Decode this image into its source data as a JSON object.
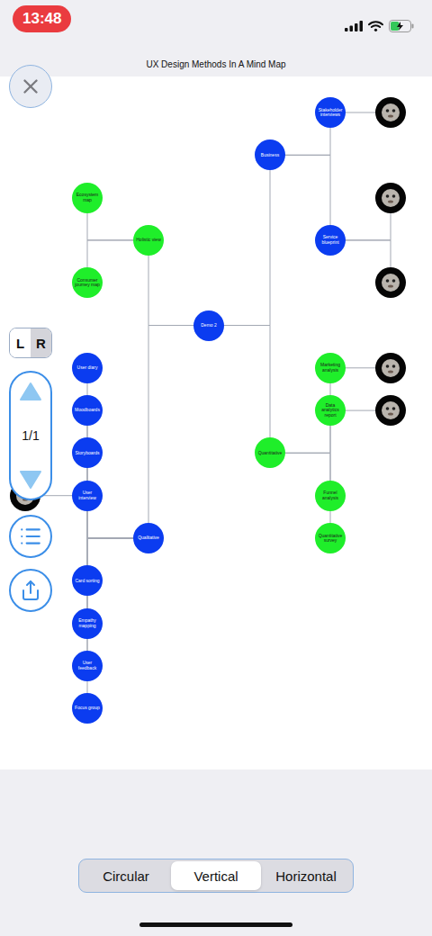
{
  "status_bar": {
    "time": "13:48",
    "battery": {
      "level": 0.45,
      "charging": true
    }
  },
  "title": "UX Design Methods In A Mind Map",
  "mindmap": {
    "root": {
      "label": "Demo 2",
      "color": "#0b3cf0"
    },
    "branches": [
      {
        "label": "Business",
        "color": "#0b3cf0",
        "children": [
          {
            "label": "Stakeholder interviews",
            "color": "#0b3cf0",
            "avatar_count": 1
          },
          {
            "label": "Service blueprint",
            "color": "#0b3cf0",
            "avatar_count": 2
          }
        ]
      },
      {
        "label": "Quantitative",
        "color": "#1fee2a",
        "children": [
          {
            "label": "Marketing analysis",
            "color": "#1fee2a",
            "avatar_count": 1
          },
          {
            "label": "Data analytics report",
            "color": "#1fee2a",
            "avatar_count": 1
          },
          {
            "label": "Funnel analysis",
            "color": "#1fee2a",
            "avatar_count": 0
          },
          {
            "label": "Quantitative survey",
            "color": "#1fee2a",
            "avatar_count": 0
          }
        ]
      },
      {
        "label": "Holistic view",
        "color": "#1fee2a",
        "children": [
          {
            "label": "Ecosystem map",
            "color": "#1fee2a",
            "avatar_count": 0
          },
          {
            "label": "Consumer journey map",
            "color": "#1fee2a",
            "avatar_count": 0
          }
        ]
      },
      {
        "label": "Qualitative",
        "color": "#0b3cf0",
        "children": [
          {
            "label": "User diary",
            "color": "#0b3cf0",
            "avatar_count": 0
          },
          {
            "label": "Moodboards",
            "color": "#0b3cf0",
            "avatar_count": 0
          },
          {
            "label": "Storyboards",
            "color": "#0b3cf0",
            "avatar_count": 0
          },
          {
            "label": "User interview",
            "color": "#0b3cf0",
            "avatar_count": 1
          },
          {
            "label": "Card sorting",
            "color": "#0b3cf0",
            "avatar_count": 0
          },
          {
            "label": "Empathy mapping",
            "color": "#0b3cf0",
            "avatar_count": 0
          },
          {
            "label": "User feedback",
            "color": "#0b3cf0",
            "avatar_count": 0
          },
          {
            "label": "Focus group",
            "color": "#0b3cf0",
            "avatar_count": 0
          }
        ]
      }
    ]
  },
  "side_toggle": [
    {
      "label": "L",
      "selected": false
    },
    {
      "label": "R",
      "selected": true
    }
  ],
  "pager": "1/1",
  "layout_tabs": [
    {
      "label": "Circular",
      "selected": false
    },
    {
      "label": "Vertical",
      "selected": true
    },
    {
      "label": "Horizontal",
      "selected": false
    }
  ]
}
